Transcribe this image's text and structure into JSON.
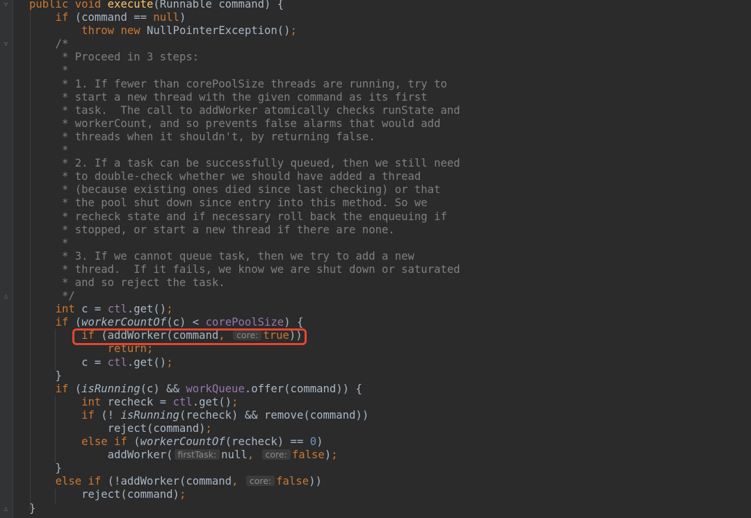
{
  "editor": {
    "language": "Java",
    "theme": "dark",
    "highlight_color": "#e8452f",
    "lines": [
      [
        {
          "t": "public void ",
          "c": "kw"
        },
        {
          "t": "execute",
          "c": "fn"
        },
        {
          "t": "(Runnable command) {"
        }
      ],
      [
        {
          "t": "    "
        },
        {
          "t": "if ",
          "c": "kw"
        },
        {
          "t": "(command == "
        },
        {
          "t": "null",
          "c": "kw"
        },
        {
          "t": ")"
        }
      ],
      [
        {
          "t": "        "
        },
        {
          "t": "throw new ",
          "c": "kw"
        },
        {
          "t": "NullPointerException()"
        },
        {
          "t": ";",
          "c": "kw"
        }
      ],
      [
        {
          "t": "    /*",
          "c": "cm"
        }
      ],
      [
        {
          "t": "     * Proceed in 3 steps:",
          "c": "cm"
        }
      ],
      [
        {
          "t": "     *",
          "c": "cm"
        }
      ],
      [
        {
          "t": "     * 1. If fewer than corePoolSize threads are running, try to",
          "c": "cm"
        }
      ],
      [
        {
          "t": "     * start a new thread with the given command as its first",
          "c": "cm"
        }
      ],
      [
        {
          "t": "     * task.  The call to addWorker atomically checks runState and",
          "c": "cm"
        }
      ],
      [
        {
          "t": "     * workerCount, and so prevents false alarms that would add",
          "c": "cm"
        }
      ],
      [
        {
          "t": "     * threads when it shouldn't, by returning false.",
          "c": "cm"
        }
      ],
      [
        {
          "t": "     *",
          "c": "cm"
        }
      ],
      [
        {
          "t": "     * 2. If a task can be successfully queued, then we still need",
          "c": "cm"
        }
      ],
      [
        {
          "t": "     * to double-check whether we should have added a thread",
          "c": "cm"
        }
      ],
      [
        {
          "t": "     * (because existing ones died since last checking) or that",
          "c": "cm"
        }
      ],
      [
        {
          "t": "     * the pool shut down since entry into this method. So we",
          "c": "cm"
        }
      ],
      [
        {
          "t": "     * recheck state and if necessary roll back the enqueuing if",
          "c": "cm"
        }
      ],
      [
        {
          "t": "     * stopped, or start a new thread if there are none.",
          "c": "cm"
        }
      ],
      [
        {
          "t": "     *",
          "c": "cm"
        }
      ],
      [
        {
          "t": "     * 3. If we cannot queue task, then we try to add a new",
          "c": "cm"
        }
      ],
      [
        {
          "t": "     * thread.  If it fails, we know we are shut down or saturated",
          "c": "cm"
        }
      ],
      [
        {
          "t": "     * and so reject the task.",
          "c": "cm"
        }
      ],
      [
        {
          "t": "     */",
          "c": "cm"
        }
      ],
      [
        {
          "t": "    "
        },
        {
          "t": "int ",
          "c": "kw"
        },
        {
          "t": "c = "
        },
        {
          "t": "ctl",
          "c": "fld"
        },
        {
          "t": ".get()"
        },
        {
          "t": ";",
          "c": "kw"
        }
      ],
      [
        {
          "t": "    "
        },
        {
          "t": "if ",
          "c": "kw"
        },
        {
          "t": "("
        },
        {
          "t": "workerCountOf",
          "c": "ital"
        },
        {
          "t": "(c) < "
        },
        {
          "t": "corePoolSize",
          "c": "fld"
        },
        {
          "t": ") {"
        }
      ],
      [
        {
          "t": "        "
        },
        {
          "t": "if ",
          "c": "kw"
        },
        {
          "t": "(addWorker(command"
        },
        {
          "t": ", ",
          "c": "kw"
        },
        {
          "hint": "core:"
        },
        {
          "t": "true",
          "c": "kw"
        },
        {
          "t": "))"
        }
      ],
      [
        {
          "t": "            "
        },
        {
          "t": "return;",
          "c": "kw"
        }
      ],
      [
        {
          "t": "        c = "
        },
        {
          "t": "ctl",
          "c": "fld"
        },
        {
          "t": ".get()"
        },
        {
          "t": ";",
          "c": "kw"
        }
      ],
      [
        {
          "t": "    }"
        }
      ],
      [
        {
          "t": "    "
        },
        {
          "t": "if ",
          "c": "kw"
        },
        {
          "t": "("
        },
        {
          "t": "isRunning",
          "c": "ital"
        },
        {
          "t": "(c) && "
        },
        {
          "t": "workQueue",
          "c": "fld"
        },
        {
          "t": ".offer(command)) {"
        }
      ],
      [
        {
          "t": "        "
        },
        {
          "t": "int ",
          "c": "kw"
        },
        {
          "t": "recheck = "
        },
        {
          "t": "ctl",
          "c": "fld"
        },
        {
          "t": ".get()"
        },
        {
          "t": ";",
          "c": "kw"
        }
      ],
      [
        {
          "t": "        "
        },
        {
          "t": "if ",
          "c": "kw"
        },
        {
          "t": "(! "
        },
        {
          "t": "isRunning",
          "c": "ital"
        },
        {
          "t": "(recheck) && remove(command))"
        }
      ],
      [
        {
          "t": "            reject(command)"
        },
        {
          "t": ";",
          "c": "kw"
        }
      ],
      [
        {
          "t": "        "
        },
        {
          "t": "else if ",
          "c": "kw"
        },
        {
          "t": "("
        },
        {
          "t": "workerCountOf",
          "c": "ital"
        },
        {
          "t": "(recheck) == "
        },
        {
          "t": "0",
          "c": "num"
        },
        {
          "t": ")"
        }
      ],
      [
        {
          "t": "            addWorker("
        },
        {
          "hint": "firstTask:"
        },
        {
          "t": "null"
        },
        {
          "t": ", ",
          "c": "kw"
        },
        {
          "hint": "core:"
        },
        {
          "t": "false",
          "c": "kw"
        },
        {
          "t": ")"
        },
        {
          "t": ";",
          "c": "kw"
        }
      ],
      [
        {
          "t": "    }"
        }
      ],
      [
        {
          "t": "    "
        },
        {
          "t": "else if ",
          "c": "kw"
        },
        {
          "t": "(!addWorker(command"
        },
        {
          "t": ", ",
          "c": "kw"
        },
        {
          "hint": "core:"
        },
        {
          "t": "false",
          "c": "kw"
        },
        {
          "t": "))"
        }
      ],
      [
        {
          "t": "        reject(command)"
        },
        {
          "t": ";",
          "c": "kw"
        }
      ],
      [
        {
          "t": "}"
        }
      ]
    ]
  }
}
